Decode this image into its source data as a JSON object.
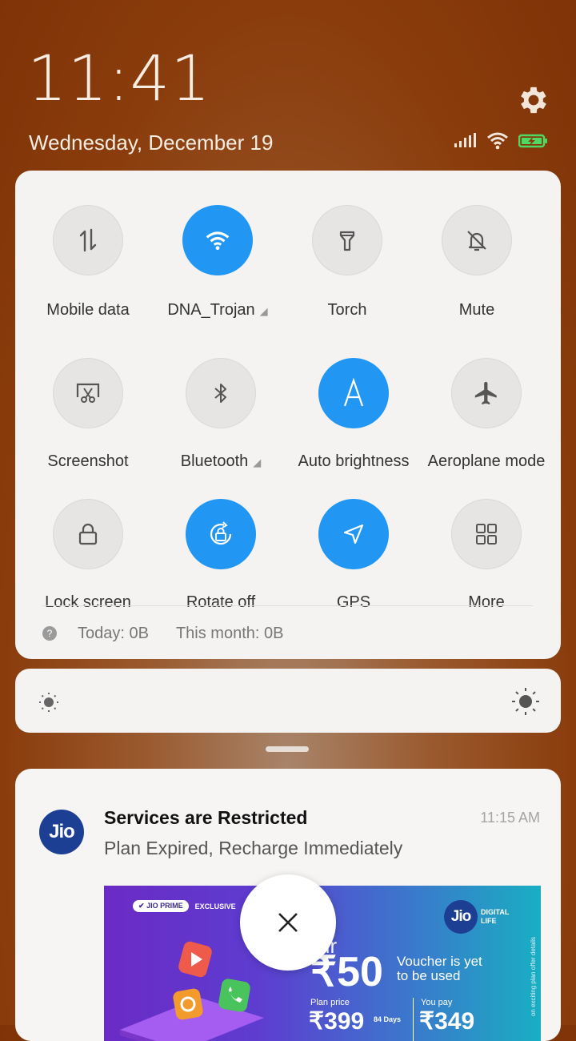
{
  "status": {
    "time": "11:41",
    "date": "Wednesday, December 19",
    "icons": [
      "signal-icon",
      "wifi-icon",
      "battery-charging-icon"
    ]
  },
  "quick_settings": {
    "tiles": [
      {
        "label": "Mobile data",
        "icon": "mobile-data-icon",
        "active": false
      },
      {
        "label": "DNA_Trojan",
        "icon": "wifi-icon",
        "active": true
      },
      {
        "label": "Torch",
        "icon": "torch-icon",
        "active": false
      },
      {
        "label": "Mute",
        "icon": "mute-icon",
        "active": false
      },
      {
        "label": "Screenshot",
        "icon": "screenshot-icon",
        "active": false
      },
      {
        "label": "Bluetooth",
        "icon": "bluetooth-icon",
        "active": false
      },
      {
        "label": "Auto brightness",
        "icon": "auto-brightness-icon",
        "active": true
      },
      {
        "label": "Aeroplane mode",
        "icon": "aeroplane-icon",
        "active": false
      },
      {
        "label": "Lock screen",
        "icon": "lock-icon",
        "active": false
      },
      {
        "label": "Rotate off",
        "icon": "rotate-lock-icon",
        "active": true
      },
      {
        "label": "GPS",
        "icon": "gps-icon",
        "active": true
      },
      {
        "label": "More",
        "icon": "grid-icon",
        "active": false
      }
    ],
    "usage_today": "Today: 0B",
    "usage_month": "This month: 0B",
    "usage_info_glyph": "?"
  },
  "notification": {
    "app_logo": "Jio",
    "title": "Services are Restricted",
    "time": "11:15 AM",
    "text": "Plan Expired, Recharge Immediately",
    "banner": {
      "badge": "JIO PRIME",
      "badge_suffix": "EXCLUSIVE",
      "brand": "Jio",
      "brand_sub1": "DIGITAL",
      "brand_sub2": "LIFE",
      "amount_prefix": "ur",
      "amount": "₹50",
      "voucher_line1": "Voucher is yet",
      "voucher_line2": "to be used",
      "plan_price_label": "Plan price",
      "plan_price": "₹399",
      "plan_days": "84 Days",
      "you_pay_label": "You pay",
      "you_pay": "₹349",
      "side_text": "on exciting plan offer details"
    }
  },
  "colors": {
    "accent": "#2196f3",
    "jio_blue": "#1c3f94",
    "wallpaper": "#8a3c0c"
  }
}
